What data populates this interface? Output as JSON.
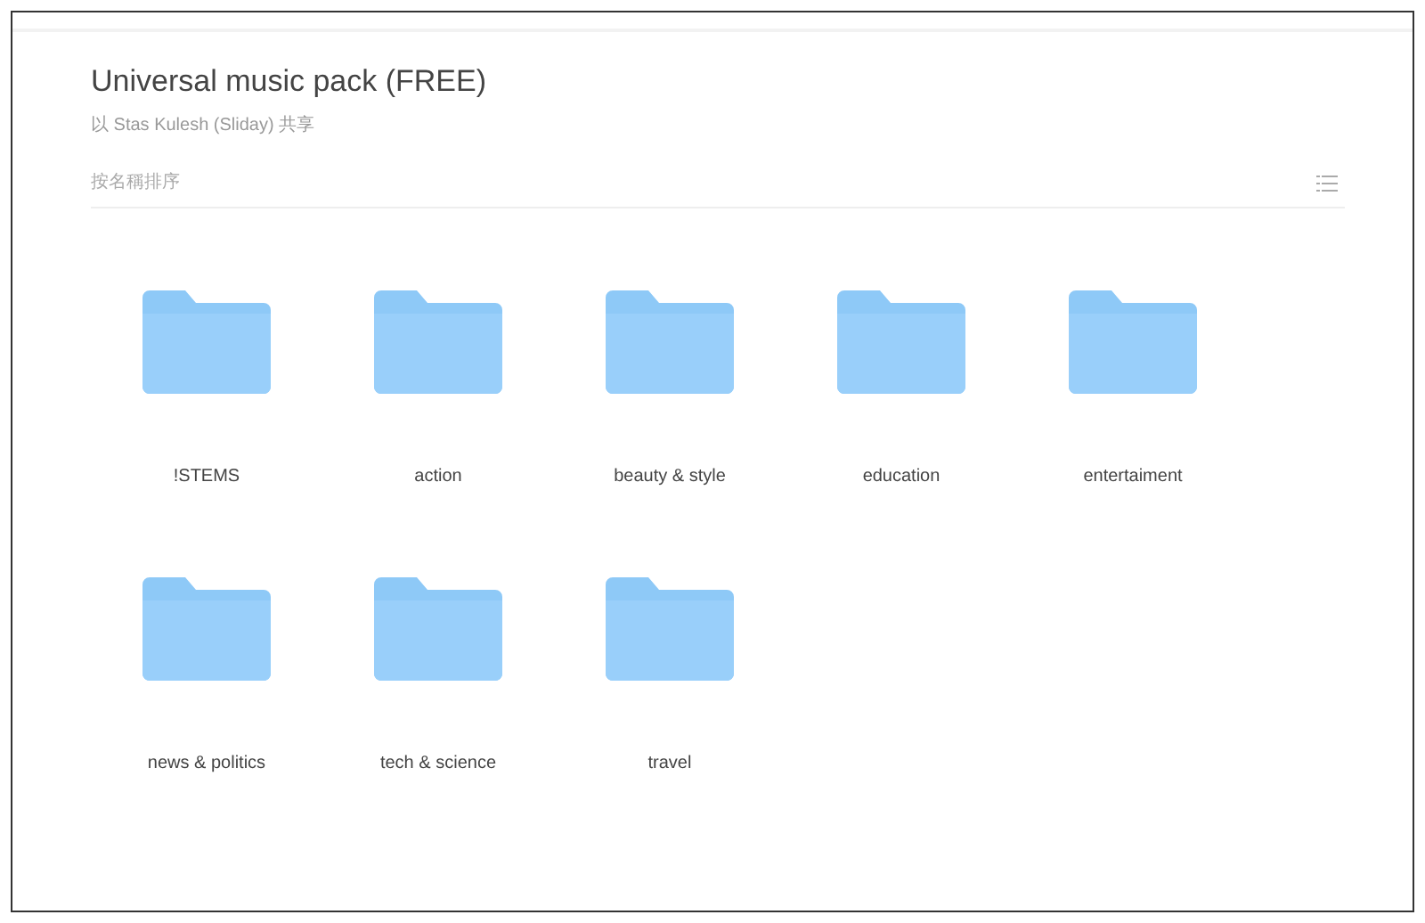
{
  "title": "Universal music pack (FREE)",
  "shared_by": "以 Stas Kulesh (Sliday) 共享",
  "sort_label": "按名稱排序",
  "folders": [
    {
      "name": "!STEMS"
    },
    {
      "name": "action"
    },
    {
      "name": "beauty & style"
    },
    {
      "name": "education"
    },
    {
      "name": "entertaiment"
    },
    {
      "name": "news & politics"
    },
    {
      "name": "tech & science"
    },
    {
      "name": "travel"
    }
  ]
}
